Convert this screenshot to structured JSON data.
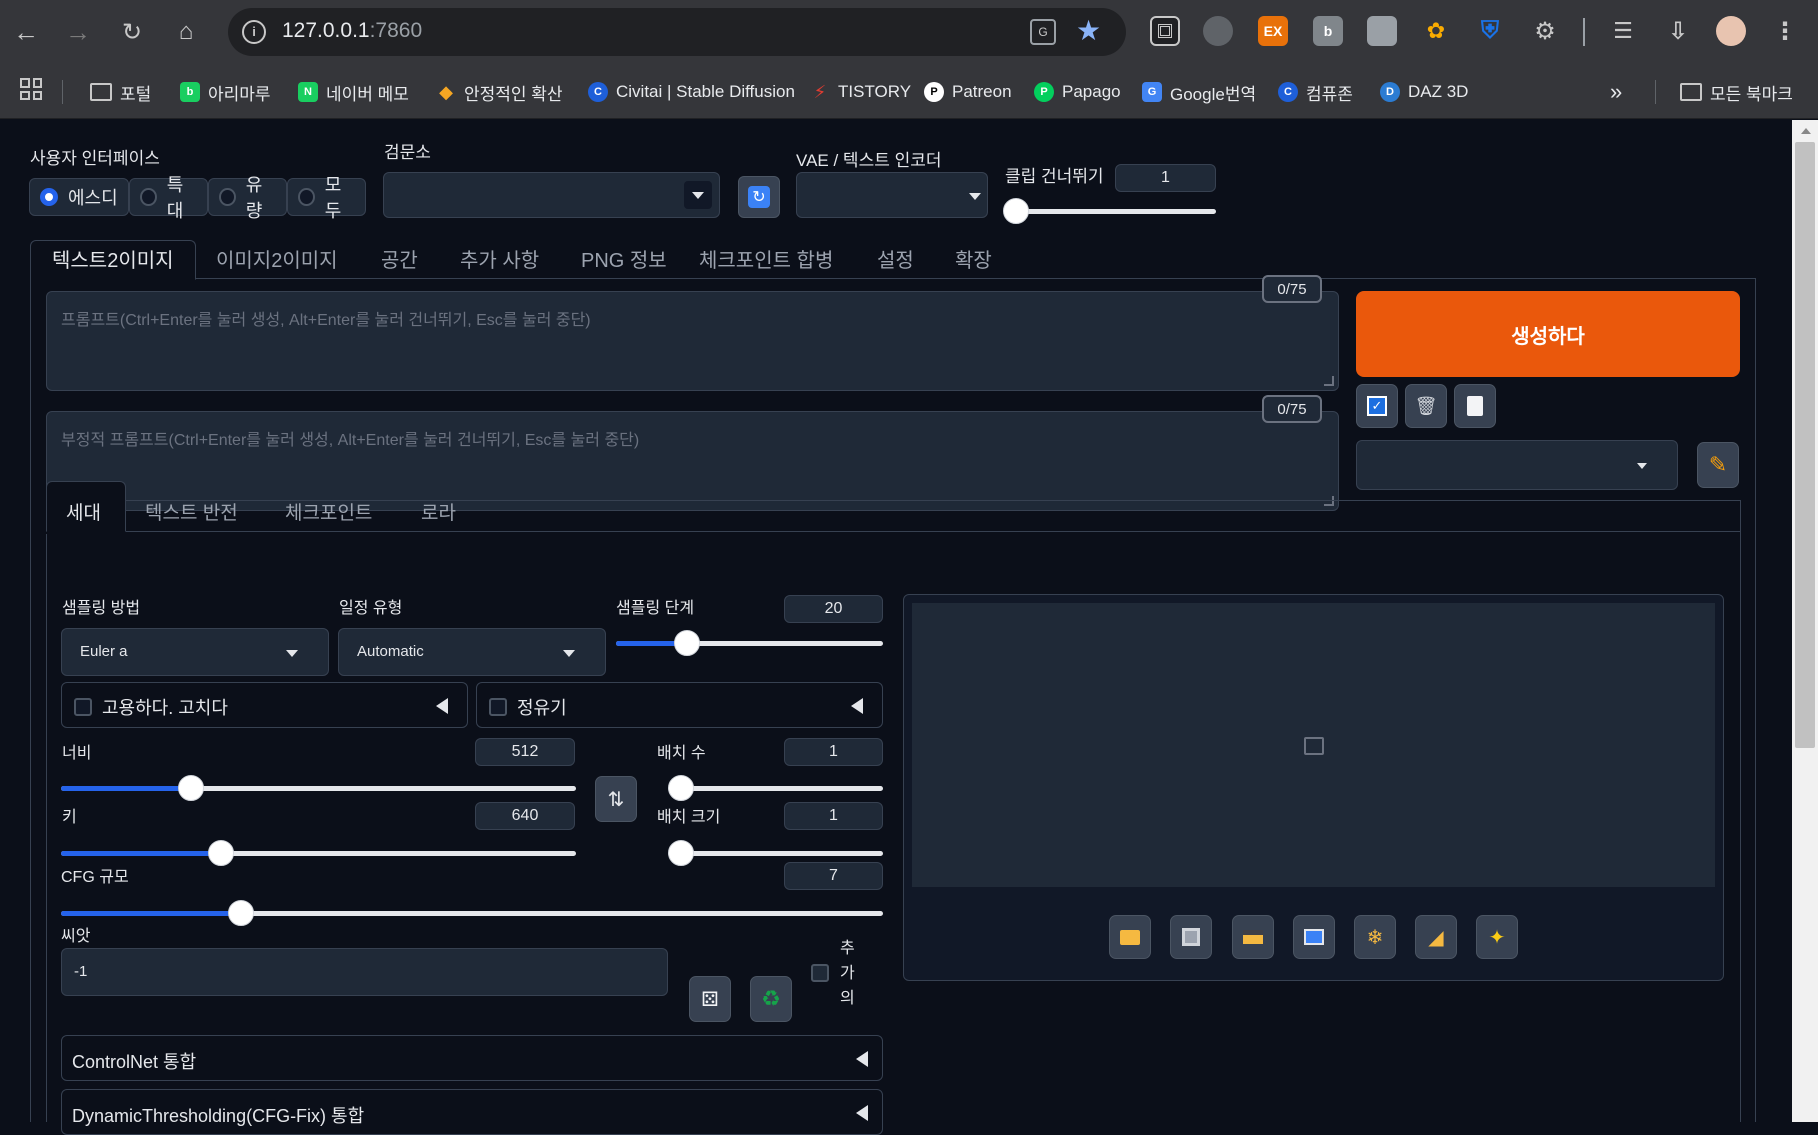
{
  "browser": {
    "url_host": "127.0.0.1",
    "url_port": ":7860",
    "bookmarks": [
      {
        "label": "포털",
        "icon": "folder-icon"
      },
      {
        "label": "아리마루",
        "icon": "blog-icon"
      },
      {
        "label": "네이버 메모",
        "icon": "naver-memo-icon"
      },
      {
        "label": "안정적인 확산",
        "icon": "stability-icon"
      },
      {
        "label": "Civitai | Stable Diffusion",
        "icon": "civitai-icon"
      },
      {
        "label": "TISTORY",
        "icon": "tistory-icon"
      },
      {
        "label": "Patreon",
        "icon": "patreon-icon"
      },
      {
        "label": "Papago",
        "icon": "papago-icon"
      },
      {
        "label": "Google번역",
        "icon": "google-translate-icon"
      },
      {
        "label": "컴퓨존",
        "icon": "compuzone-icon"
      },
      {
        "label": "DAZ 3D",
        "icon": "daz3d-icon"
      }
    ],
    "all_bookmarks": "모든 북마크",
    "more": "»",
    "ext_ex": "EX",
    "ext_b": "b"
  },
  "top": {
    "ui_label": "사용자 인터페이스",
    "ui_options": [
      "에스디",
      "특대",
      "유량",
      "모두"
    ],
    "ui_selected": "에스디",
    "checkpoint_label": "검문소",
    "checkpoint_value": "",
    "vae_label": "VAE / 텍스트 인코더",
    "vae_value": "",
    "clip_label": "클립 건너뛰기",
    "clip_value": "1"
  },
  "main_tabs": [
    "텍스트2이미지",
    "이미지2이미지",
    "공간",
    "추가 사항",
    "PNG 정보",
    "체크포인트 합병",
    "설정",
    "확장"
  ],
  "main_tab_active": "텍스트2이미지",
  "prompt": {
    "placeholder": "프롬프트(Ctrl+Enter를 눌러 생성, Alt+Enter를 눌러 건너뛰기, Esc를 눌러 중단)",
    "counter": "0/75",
    "neg_placeholder": "부정적 프롬프트(Ctrl+Enter를 눌러 생성, Alt+Enter를 눌러 건너뛰기, Esc를 눌러 중단)",
    "neg_counter": "0/75"
  },
  "generate_label": "생성하다",
  "style_value": "",
  "sub_tabs": [
    "세대",
    "텍스트 반전",
    "체크포인트",
    "로라"
  ],
  "sub_tab_active": "세대",
  "generation": {
    "sampler_label": "샘플링 방법",
    "sampler_value": "Euler a",
    "schedule_label": "일정 유형",
    "schedule_value": "Automatic",
    "steps_label": "샘플링 단계",
    "steps_value": "20",
    "steps_level": 0.24,
    "hires_label": "고용하다. 고치다",
    "refiner_label": "정유기",
    "width_label": "너비",
    "width_value": "512",
    "width_level": 0.24,
    "height_label": "키",
    "height_value": "640",
    "height_level": 0.3,
    "batch_count_label": "배치 수",
    "batch_count_value": "1",
    "batch_count_level": 0.0,
    "batch_size_label": "배치 크기",
    "batch_size_value": "1",
    "batch_size_level": 0.0,
    "cfg_label": "CFG 규모",
    "cfg_value": "7",
    "cfg_level": 0.21,
    "seed_label": "씨앗",
    "seed_value": "-1",
    "extra_label_chars": [
      "추",
      "가",
      "의"
    ],
    "controlnet_label": "ControlNet 통합",
    "dynthres_label": "DynamicThresholding(CFG-Fix) 통합"
  },
  "output_icons": [
    "folder-icon",
    "save-icon",
    "zip-icon",
    "image-icon",
    "palette-icon",
    "ruler-icon",
    "sparkle-icon"
  ]
}
